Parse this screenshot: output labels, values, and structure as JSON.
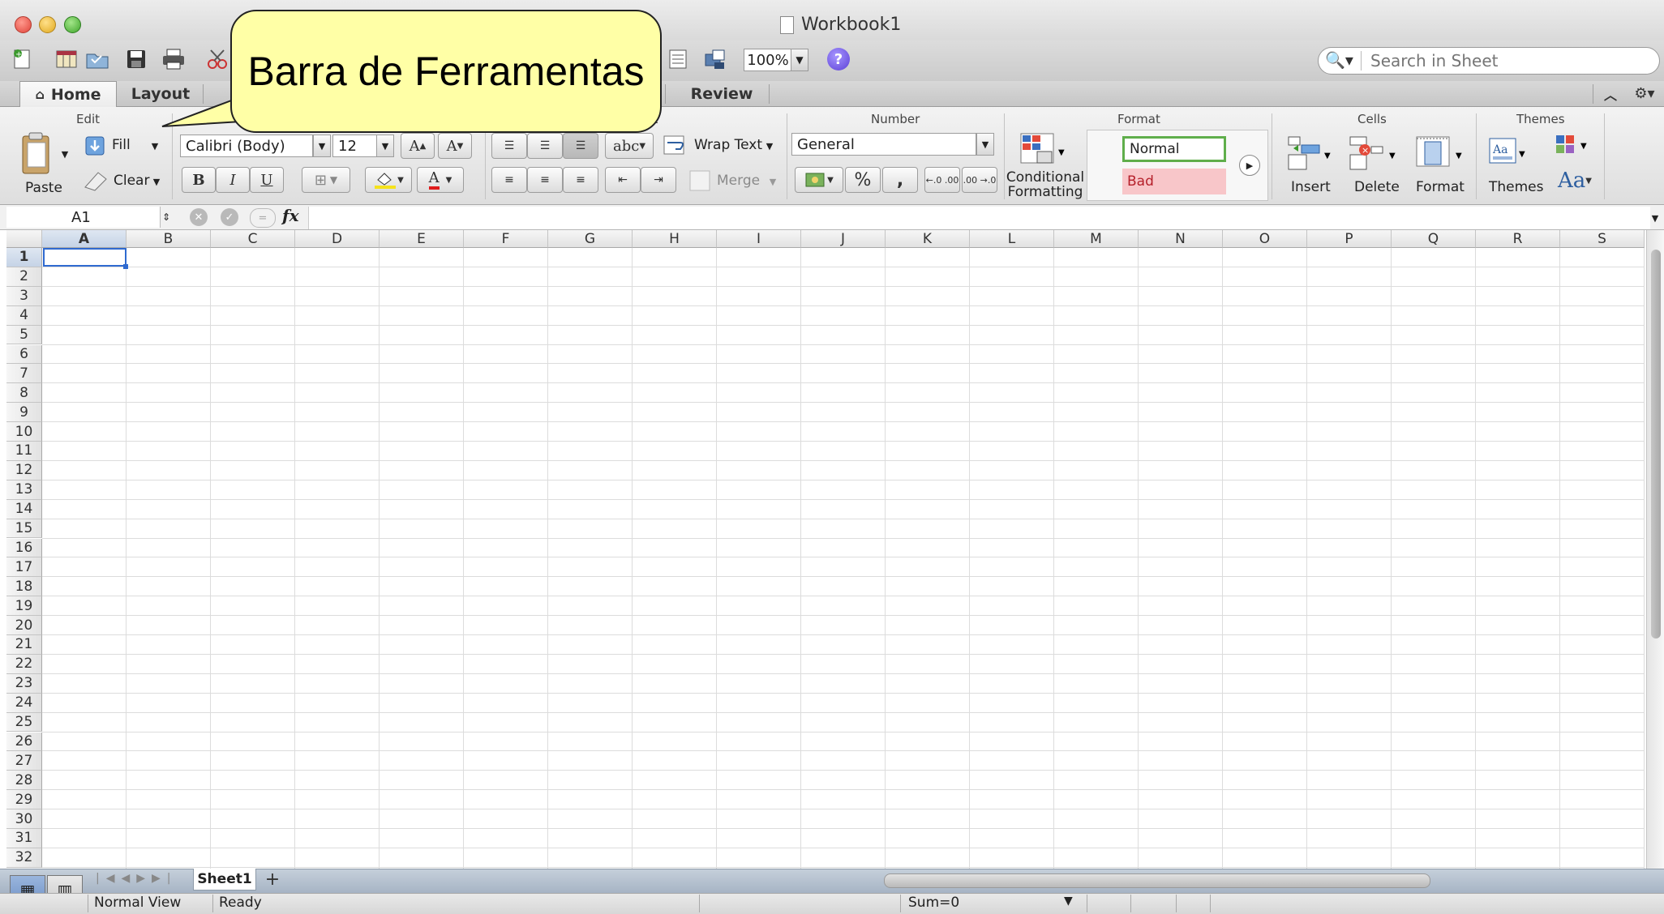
{
  "window": {
    "title": "Workbook1"
  },
  "toolbar": {
    "zoom": "100%",
    "help_label": "?",
    "search_placeholder": "Search in Sheet"
  },
  "tabs": [
    {
      "label": "Home",
      "active": true
    },
    {
      "label": "Layout"
    },
    {
      "label": "Review"
    }
  ],
  "ribbon": {
    "groups": {
      "edit": "Edit",
      "alignment_fragment": "nt",
      "number": "Number",
      "format": "Format",
      "cells": "Cells",
      "themes": "Themes"
    },
    "paste": "Paste",
    "fill": "Fill",
    "clear": "Clear",
    "font_name": "Calibri (Body)",
    "font_size": "12",
    "bold": "B",
    "italic": "I",
    "underline": "U",
    "grow_font": "A",
    "shrink_font": "A",
    "font_color": "A",
    "wrap_orient": "abc",
    "wrap_text": "Wrap Text",
    "merge": "Merge",
    "number_format": "General",
    "percent": "%",
    "comma": ",",
    "dec_inc": "←.0 .00",
    "dec_dec": ".00 →.0",
    "conditional_line1": "Conditional",
    "conditional_line2": "Formatting",
    "style_normal": "Normal",
    "style_bad": "Bad",
    "insert": "Insert",
    "delete": "Delete",
    "format": "Format",
    "themes": "Themes",
    "theme_fonts": "Aa",
    "theme_thumb": "Aa"
  },
  "formula_bar": {
    "name_box": "A1",
    "fx": "fx",
    "formula": ""
  },
  "grid": {
    "columns": [
      "A",
      "B",
      "C",
      "D",
      "E",
      "F",
      "G",
      "H",
      "I",
      "J",
      "K",
      "L",
      "M",
      "N",
      "O",
      "P",
      "Q",
      "R",
      "S"
    ],
    "rows": [
      "1",
      "2",
      "3",
      "4",
      "5",
      "6",
      "7",
      "8",
      "9",
      "10",
      "11",
      "12",
      "13",
      "14",
      "15",
      "16",
      "17",
      "18",
      "19",
      "20",
      "21",
      "22",
      "23",
      "24",
      "25",
      "26",
      "27",
      "28",
      "29",
      "30",
      "31",
      "32"
    ],
    "selected_cell": "A1"
  },
  "sheets": {
    "tabs": [
      "Sheet1"
    ],
    "add": "+"
  },
  "status": {
    "view": "Normal View",
    "state": "Ready",
    "sum": "Sum=0"
  },
  "callout": {
    "text": "Barra de Ferramentas"
  },
  "colors": {
    "accent": "#2f6ad0",
    "callout_fill": "#ffffa6",
    "style_bad_fill": "#f8c6c9",
    "style_normal_border": "#5fae4b"
  }
}
